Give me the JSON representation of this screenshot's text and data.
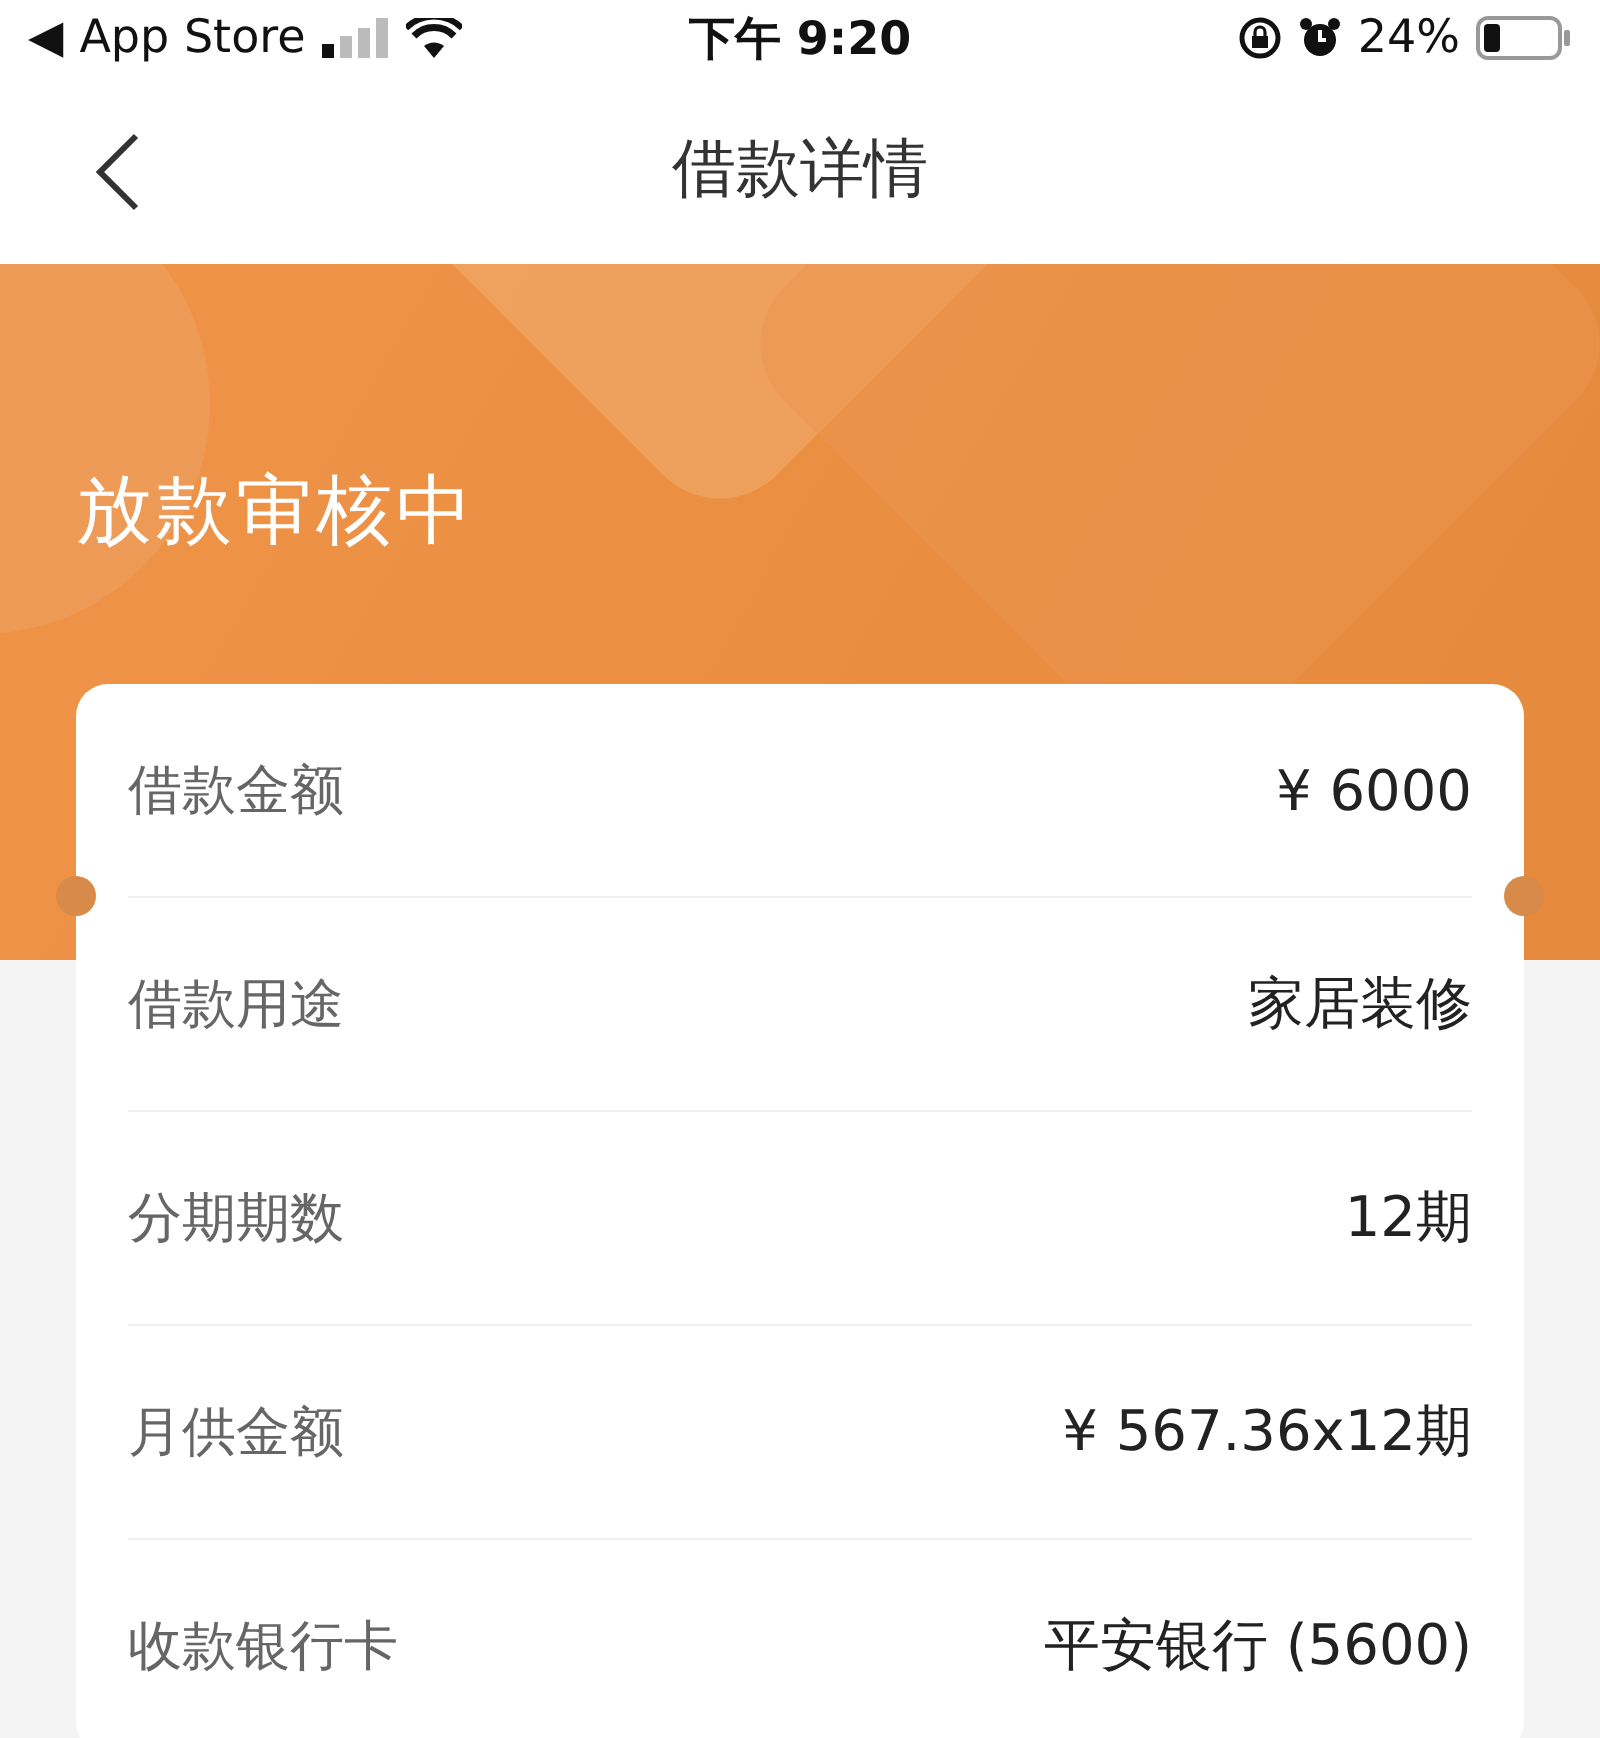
{
  "status_bar": {
    "back_glyph": "◀",
    "back_app": "App Store",
    "time": "下午 9:20",
    "battery": "24%"
  },
  "nav": {
    "title": "借款详情"
  },
  "banner": {
    "status": "放款审核中"
  },
  "details": [
    {
      "label": "借款金额",
      "value": "¥ 6000"
    },
    {
      "label": "借款用途",
      "value": "家居装修"
    },
    {
      "label": "分期期数",
      "value": "12期"
    },
    {
      "label": "月供金额",
      "value": "¥ 567.36x12期"
    },
    {
      "label": "收款银行卡",
      "value": "平安银行 (5600)"
    }
  ]
}
